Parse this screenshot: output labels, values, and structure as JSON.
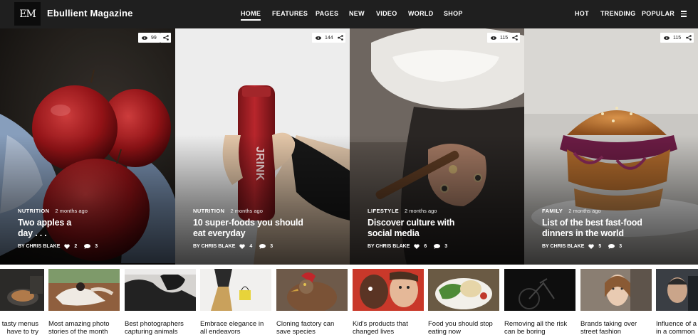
{
  "brand": {
    "logo": "EM",
    "name": "Ebullient Magazine"
  },
  "nav": {
    "primary": [
      {
        "label": "HOME",
        "active": true
      },
      {
        "label": "FEATURES"
      },
      {
        "label": "PAGES"
      },
      {
        "label": "NEW"
      },
      {
        "label": "VIDEO"
      },
      {
        "label": "WORLD"
      },
      {
        "label": "SHOP"
      }
    ],
    "secondary": [
      {
        "label": "HOT"
      },
      {
        "label": "TRENDING"
      },
      {
        "label": "POPULAR"
      }
    ],
    "menu_icon": "hamburger-icon"
  },
  "featured": [
    {
      "views": "99",
      "category": "NUTRITION",
      "time": "2 months ago",
      "title": "Two apples a day . . .",
      "author": "BY CHRIS BLAKE",
      "likes": "2",
      "comments": "3",
      "image": "red apples on blue patterned cloth"
    },
    {
      "views": "144",
      "category": "NUTRITION",
      "time": "2 months ago",
      "title": "10 super-foods you should eat everyday",
      "author": "BY CHRIS BLAKE",
      "likes": "4",
      "comments": "3",
      "image": "hand holding red juice bottle"
    },
    {
      "views": "115",
      "category": "LIFESTYLE",
      "time": "2 months ago",
      "title": "Discover culture with social media",
      "author": "BY CHRIS BLAKE",
      "likes": "6",
      "comments": "3",
      "image": "man in white hat with cigar"
    },
    {
      "views": "115",
      "category": "FAMILY",
      "time": "2 months ago",
      "title": "List of the best fast-food dinners in the world",
      "author": "BY CHRIS BLAKE",
      "likes": "5",
      "comments": "3",
      "image": "burger with red onion"
    }
  ],
  "strip": [
    {
      "title": "Tasty menus to have to try",
      "visible_title": "tasty menus\nhave to try"
    },
    {
      "title": "Most amazing photo stories of the month"
    },
    {
      "title": "Best photographers capturing animals"
    },
    {
      "title": "Embrace elegance in all endeavors"
    },
    {
      "title": "Cloning factory can save species"
    },
    {
      "title": "Kid's products that changed lives"
    },
    {
      "title": "Food you should stop eating now"
    },
    {
      "title": "Removing all the risk can be boring"
    },
    {
      "title": "Brands taking over street fashion"
    },
    {
      "title": "Influence of a in a common"
    }
  ],
  "icons": {
    "views": "eye-icon",
    "share": "share-icon",
    "likes": "heart-icon",
    "comments": "comment-icon"
  },
  "colors": {
    "nav_bg": "#1f1f1f",
    "logo_bg": "#0c0c0c",
    "text_light": "#ffffff"
  }
}
